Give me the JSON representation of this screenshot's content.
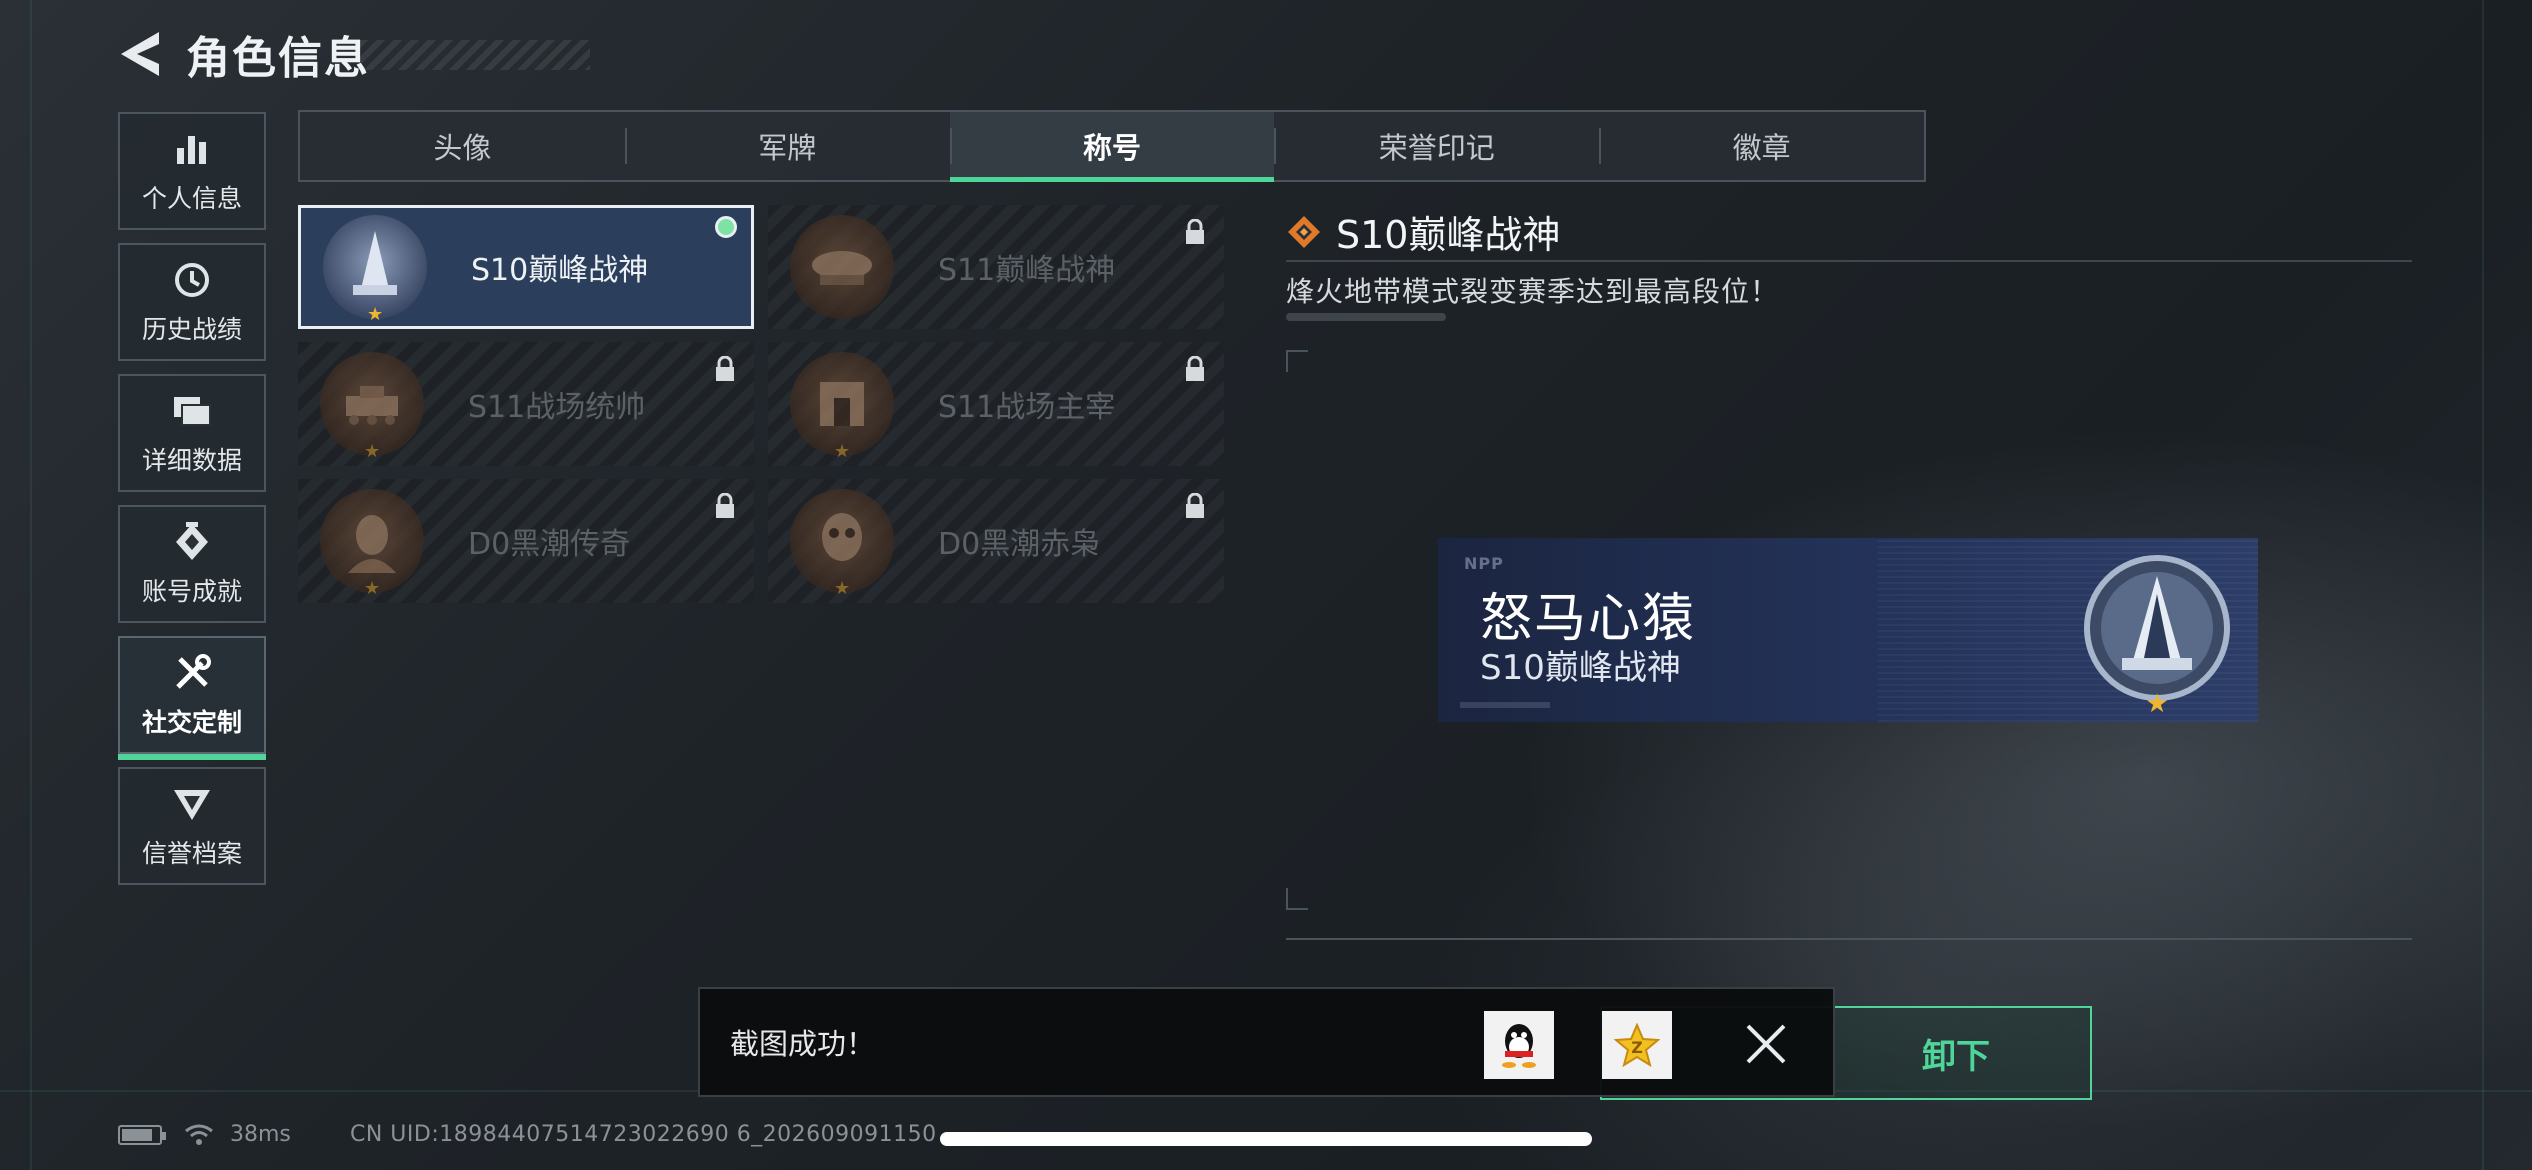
{
  "header": {
    "title": "角色信息"
  },
  "sidebar": {
    "items": [
      {
        "label": "个人信息",
        "icon": "bar-chart-icon"
      },
      {
        "label": "历史战绩",
        "icon": "history-clock-icon"
      },
      {
        "label": "详细数据",
        "icon": "folder-icon"
      },
      {
        "label": "账号成就",
        "icon": "achievement-icon"
      },
      {
        "label": "社交定制",
        "icon": "tools-icon",
        "active": true
      },
      {
        "label": "信誉档案",
        "icon": "reputation-icon"
      }
    ]
  },
  "tabs": [
    {
      "label": "头像"
    },
    {
      "label": "军牌"
    },
    {
      "label": "称号",
      "active": true
    },
    {
      "label": "荣誉印记"
    },
    {
      "label": "徽章"
    }
  ],
  "titles": [
    {
      "label": "S10巅峰战神",
      "selected": true,
      "equipped": true,
      "locked": false
    },
    {
      "label": "S11巅峰战神",
      "locked": true
    },
    {
      "label": "S11战场统帅",
      "locked": true
    },
    {
      "label": "S11战场主宰",
      "locked": true
    },
    {
      "label": "D0黑潮传奇",
      "locked": true
    },
    {
      "label": "D0黑潮赤枭",
      "locked": true
    }
  ],
  "detail": {
    "title": "S10巅峰战神",
    "description": "烽火地带模式裂变赛季达到最高段位！"
  },
  "name_plate": {
    "logo": "NPP",
    "player_name": "怒马心猿",
    "title": "S10巅峰战神"
  },
  "actions": {
    "unequip_label": "卸下"
  },
  "toast": {
    "message": "截图成功！"
  },
  "status_bar": {
    "ping": "38ms",
    "uid": "CN UID:18984407514723022690 6_202609091150"
  },
  "colors": {
    "accent": "#4fd59a",
    "selected_card": "#2b3f5c",
    "star": "#f0b530"
  }
}
